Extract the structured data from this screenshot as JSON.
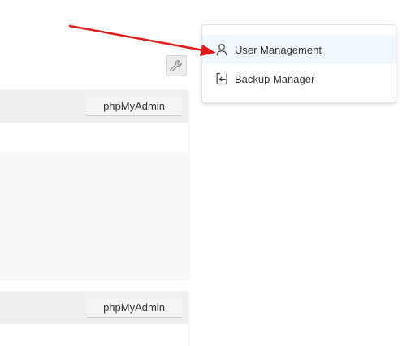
{
  "toolbar": {
    "settings_icon": "wrench-icon"
  },
  "panels": [
    {
      "button_label": "phpMyAdmin"
    },
    {
      "button_label": "phpMyAdmin"
    }
  ],
  "menu": {
    "items": [
      {
        "label": "User Management",
        "icon": "user-icon",
        "highlighted": true
      },
      {
        "label": "Backup Manager",
        "icon": "backup-restore-icon",
        "highlighted": false
      }
    ]
  },
  "annotation": {
    "arrow_color": "#e01b1b",
    "points_to": "User Management"
  },
  "colors": {
    "highlight_bg": "#f0f8fd",
    "panel_header_bg": "#efefef"
  }
}
